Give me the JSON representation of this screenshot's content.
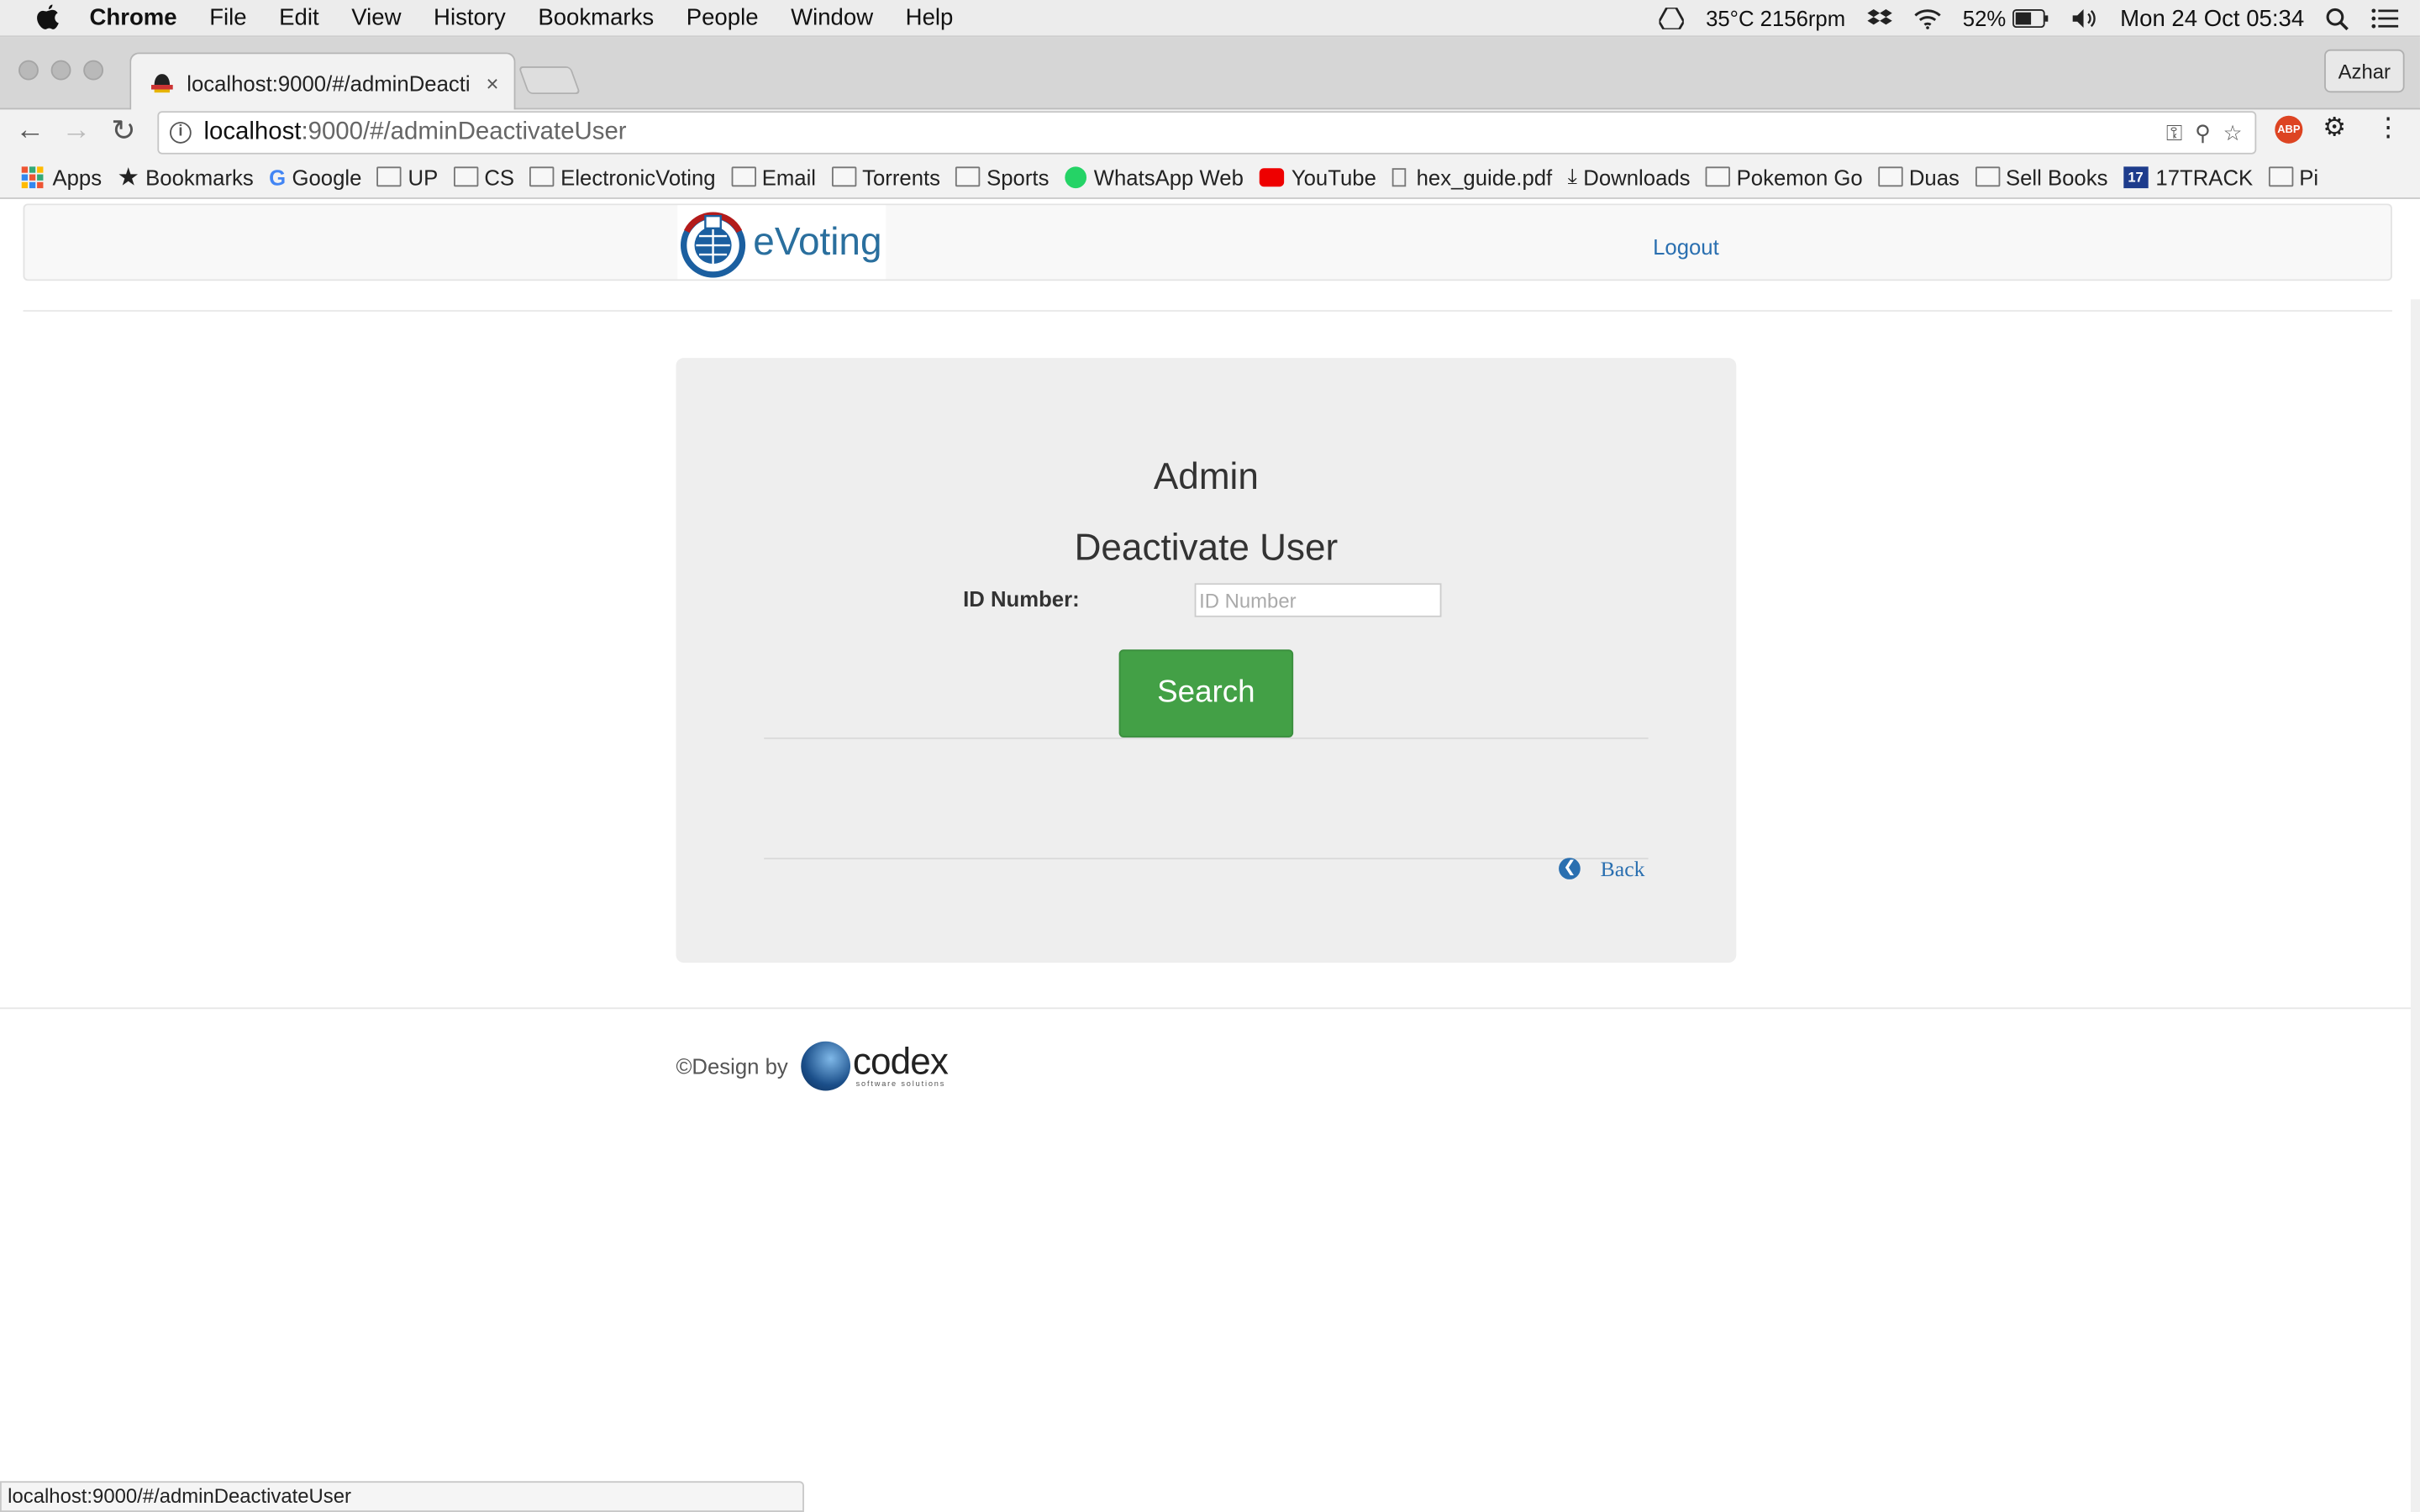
{
  "menubar": {
    "app": "Chrome",
    "items": [
      "File",
      "Edit",
      "View",
      "History",
      "Bookmarks",
      "People",
      "Window",
      "Help"
    ],
    "status": {
      "temp_rpm": "35°C 2156rpm",
      "battery": "52%",
      "datetime": "Mon 24 Oct  05:34"
    }
  },
  "tab": {
    "title": "localhost:9000/#/adminDeacti",
    "close": "×"
  },
  "profile": "Azhar",
  "omnibox": {
    "host": "localhost",
    "path": ":9000/#/adminDeactivateUser"
  },
  "bookmarks": [
    {
      "label": "Apps",
      "icon": "apps-icon"
    },
    {
      "label": "Bookmarks",
      "icon": "star-icon"
    },
    {
      "label": "Google",
      "icon": "google-icon"
    },
    {
      "label": "UP",
      "icon": "folder-icon"
    },
    {
      "label": "CS",
      "icon": "folder-icon"
    },
    {
      "label": "ElectronicVoting",
      "icon": "folder-icon"
    },
    {
      "label": "Email",
      "icon": "folder-icon"
    },
    {
      "label": "Torrents",
      "icon": "folder-icon"
    },
    {
      "label": "Sports",
      "icon": "folder-icon"
    },
    {
      "label": "WhatsApp Web",
      "icon": "whatsapp-icon"
    },
    {
      "label": "YouTube",
      "icon": "youtube-icon"
    },
    {
      "label": "hex_guide.pdf",
      "icon": "file-icon"
    },
    {
      "label": "Downloads",
      "icon": "download-icon"
    },
    {
      "label": "Pokemon Go",
      "icon": "folder-icon"
    },
    {
      "label": "Duas",
      "icon": "folder-icon"
    },
    {
      "label": "Sell Books",
      "icon": "folder-icon"
    },
    {
      "label": "17TRACK",
      "icon": "17track-icon"
    },
    {
      "label": "Pi",
      "icon": "folder-icon"
    }
  ],
  "navbar": {
    "logo_text": "eVoting",
    "logout": "Logout"
  },
  "panel": {
    "heading": "Admin",
    "subheading": "Deactivate User",
    "id_label": "ID Number:",
    "id_placeholder": "ID Number",
    "id_value": "",
    "search_button": "Search",
    "back_link": "Back"
  },
  "footer": {
    "design_by": "©Design by",
    "brand": "codex",
    "brand_tagline": "software solutions"
  },
  "statusbar": "localhost:9000/#/adminDeactivateUser",
  "colors": {
    "primary_button": "#43a046",
    "link": "#2a6fb0",
    "panel_bg": "#eeeeee"
  }
}
